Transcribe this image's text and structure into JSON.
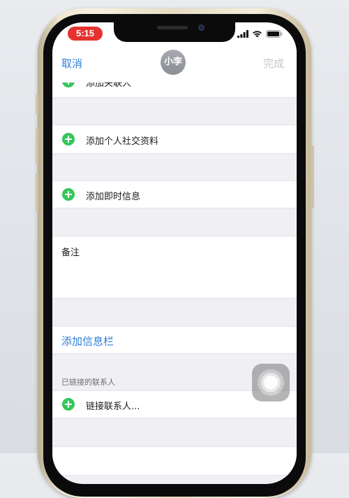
{
  "status_bar": {
    "time": "5:15",
    "icons": [
      "signal-icon",
      "wifi-icon",
      "battery-icon"
    ]
  },
  "nav": {
    "cancel_label": "取消",
    "avatar_text": "小李",
    "done_label": "完成"
  },
  "rows": {
    "add_related_label": "添加关联人",
    "add_social_label": "添加个人社交资料",
    "add_im_label": "添加即时信息",
    "notes_label": "备注",
    "add_field_label": "添加信息栏",
    "linked_contacts_header": "已链接的联系人",
    "link_contact_label": "链接联系人..."
  },
  "colors": {
    "accent": "#2f7ed8",
    "add_green": "#34c759",
    "time_pill_red": "#e5322f",
    "disabled": "#c5c6cb"
  }
}
